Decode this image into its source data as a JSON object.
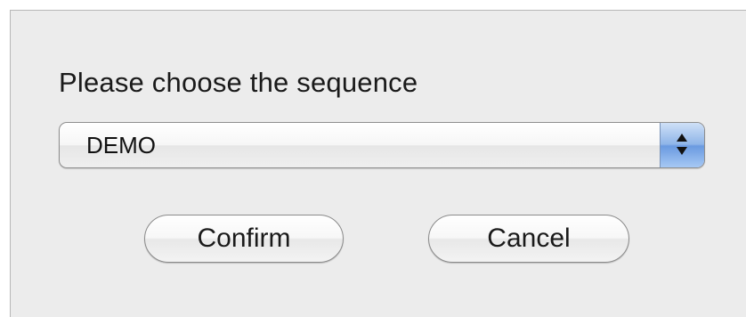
{
  "dialog": {
    "prompt": "Please choose the sequence",
    "sequence_select": {
      "selected_value": "DEMO",
      "arrow_icon": "up-down-arrows-icon"
    },
    "buttons": {
      "confirm_label": "Confirm",
      "cancel_label": "Cancel"
    }
  },
  "colors": {
    "dialog_background": "#ececec",
    "select_accent": "#6a9ae0"
  }
}
